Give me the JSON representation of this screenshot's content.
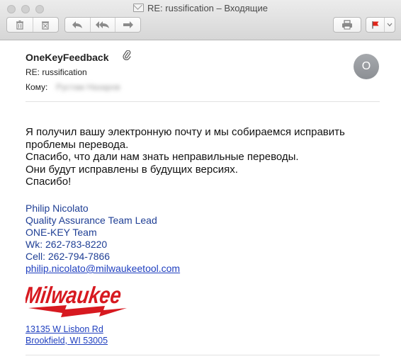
{
  "window": {
    "title": "RE: russification – Входящие"
  },
  "toolbar": {
    "buttons": [
      "trash-icon",
      "junk-icon",
      "reply-icon",
      "reply-all-icon",
      "forward-icon",
      "print-icon",
      "flag-icon",
      "chevron-down-icon"
    ]
  },
  "message": {
    "sender": "OneKeyFeedback",
    "subject": "RE: russification",
    "to_label": "Кому:",
    "to_value": "Рустам Назаров",
    "avatar_initial": "O",
    "body_lines": [
      "Я получил вашу электронную почту и мы собираемся исправить",
      "проблемы перевода.",
      "Спасибо, что дали нам знать неправильные переводы.",
      "Они будут исправлены в будущих версиях.",
      "Спасибо!"
    ],
    "signature": {
      "name": "Philip Nicolato",
      "role": "Quality Assurance Team Lead",
      "team": "ONE-KEY Team",
      "work": "Wk: 262-783-8220",
      "cell": "Cell: 262-794-7866",
      "email": "philip.nicolato@milwaukeetool.com"
    },
    "logo_text": "Milwaukee",
    "address_line1": "13135 W Lisbon Rd",
    "address_line2": "Brookfield, WI 53005"
  },
  "colors": {
    "signature_blue": "#1f3f95",
    "link_blue": "#1f3fbf",
    "logo_red": "#d71920",
    "flag_red": "#e0261b"
  }
}
